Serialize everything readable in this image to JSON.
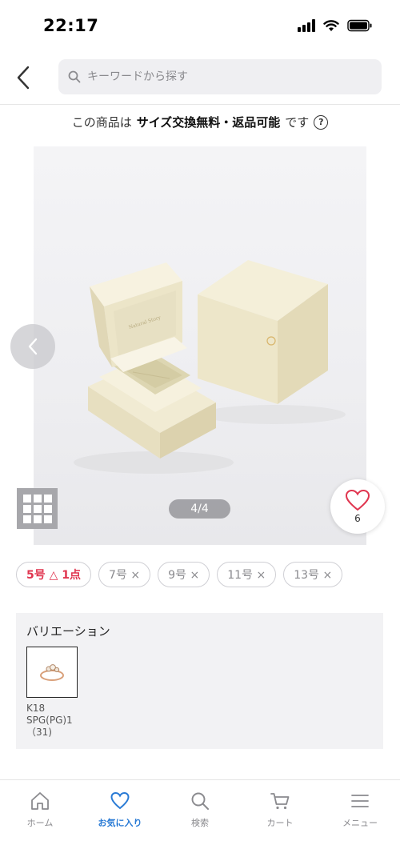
{
  "status_bar": {
    "time": "22:17"
  },
  "header": {
    "search_placeholder": "キーワードから探す"
  },
  "notice": {
    "prefix": "この商品は",
    "highlight": "サイズ交換無料・返品可能",
    "suffix": "です"
  },
  "gallery": {
    "counter": "4/4",
    "favorite_count": "6"
  },
  "sizes": [
    {
      "label": "5号 △ 1点"
    },
    {
      "label": "7号 ×"
    },
    {
      "label": "9号 ×"
    },
    {
      "label": "11号 ×"
    },
    {
      "label": "13号 ×"
    }
  ],
  "variation": {
    "title": "バリエーション",
    "items": [
      {
        "label": "K18 SPG(PG)1（31)"
      }
    ]
  },
  "tabbar": {
    "items": [
      {
        "label": "ホーム",
        "icon": "home-icon"
      },
      {
        "label": "お気に入り",
        "icon": "heart-icon",
        "active": true
      },
      {
        "label": "検索",
        "icon": "search-icon"
      },
      {
        "label": "カート",
        "icon": "cart-icon"
      },
      {
        "label": "メニュー",
        "icon": "menu-icon"
      }
    ]
  },
  "colors": {
    "accent": "#2a7bd5",
    "sale_red": "#e0354f",
    "heart_pink": "#e0354f"
  }
}
